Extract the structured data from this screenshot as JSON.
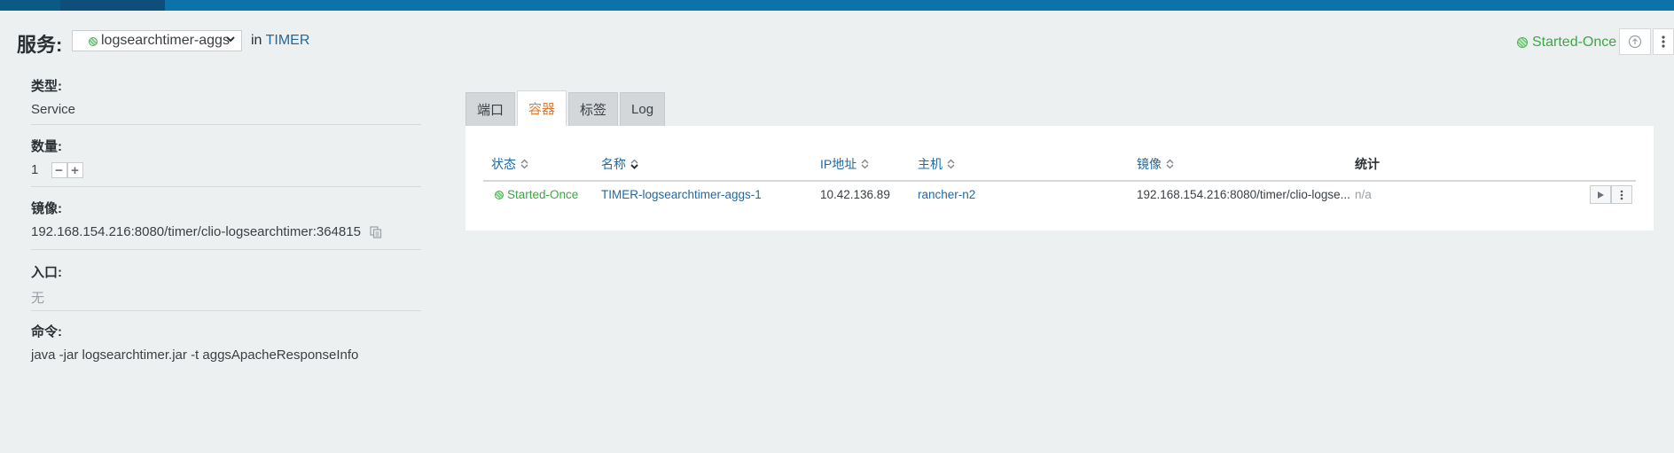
{
  "header": {
    "service_label": "服务:",
    "service_name": "logsearchtimer-aggs",
    "in_label": "in",
    "stack_name": "TIMER",
    "state": "Started-Once"
  },
  "details": [
    {
      "label": "类型:",
      "value": "Service"
    },
    {
      "label": "数量:",
      "value": "1"
    },
    {
      "label": "镜像:",
      "value": "192.168.154.216:8080/timer/clio-logsearchtimer:364815"
    },
    {
      "label": "入口:",
      "value": "无"
    },
    {
      "label": "命令:",
      "value": "java -jar logsearchtimer.jar -t aggsApacheResponseInfo"
    }
  ],
  "tabs": [
    {
      "label": "端口",
      "active": false
    },
    {
      "label": "容器",
      "active": true
    },
    {
      "label": "标签",
      "active": false
    },
    {
      "label": "Log",
      "active": false
    }
  ],
  "table": {
    "columns": [
      "状态",
      "名称",
      "IP地址",
      "主机",
      "镜像",
      "统计"
    ],
    "rows": [
      {
        "state": "Started-Once",
        "name": "TIMER-logsearchtimer-aggs-1",
        "ip": "10.42.136.89",
        "host": "rancher-n2",
        "image": "192.168.154.216:8080/timer/clio-logse...",
        "stats": "n/a"
      }
    ]
  },
  "icons": {
    "state_dot": "status-dot-icon",
    "copy": "copy-icon",
    "play": "play-icon",
    "more": "kebab-icon",
    "upgrade": "upgrade-icon"
  },
  "colors": {
    "accent": "#1f6aa2",
    "active_tab": "#e8792b",
    "success": "#3aa842",
    "topbar": "#0b73aa"
  }
}
